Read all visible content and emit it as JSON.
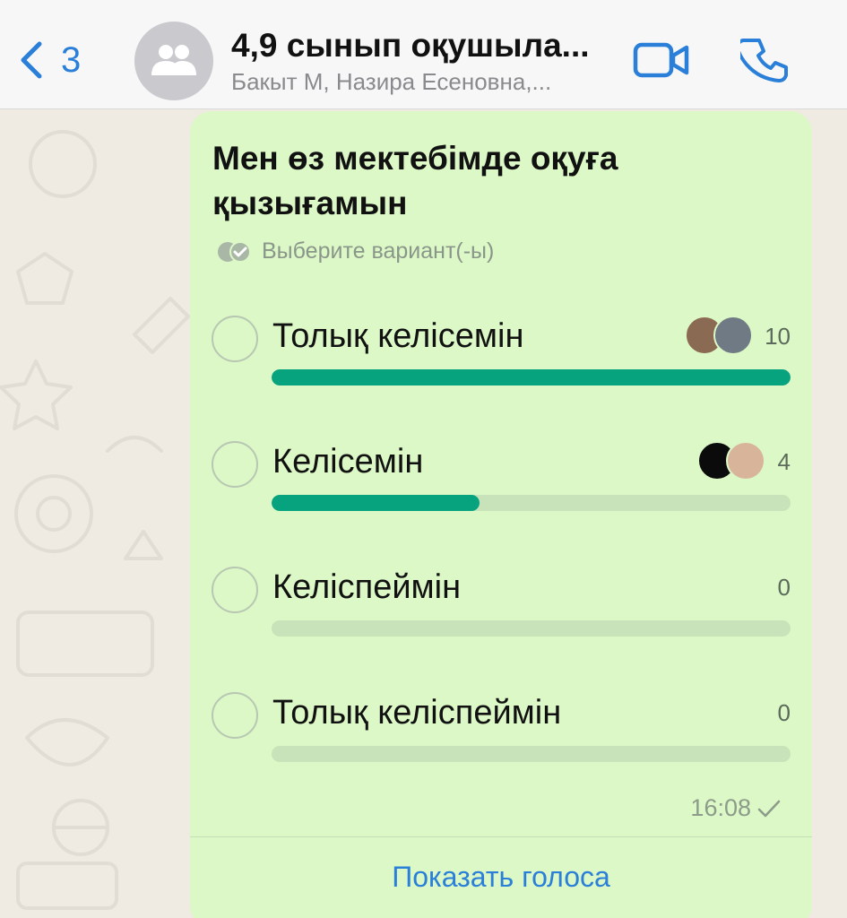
{
  "header": {
    "back_count": "3",
    "title": "4,9 сынып оқушыла...",
    "subtitle": "Бакыт М, Назира Есеновна,...",
    "icons": {
      "back": "chevron-left-icon",
      "avatar": "group-icon",
      "video": "video-camera-icon",
      "call": "phone-icon"
    }
  },
  "poll": {
    "question": "Мен өз мектебімде оқуға қызығамын",
    "hint": "Выберите вариант(-ы)",
    "options": [
      {
        "label": "Толық келісемін",
        "count": "10",
        "fraction": 1.0,
        "voters": [
          "#8a6a52",
          "#6f7a84"
        ]
      },
      {
        "label": "Келісемін",
        "count": "4",
        "fraction": 0.4,
        "voters": [
          "#0b0b0b",
          "#d8b49a"
        ]
      },
      {
        "label": "Келіспеймін",
        "count": "0",
        "fraction": 0,
        "voters": []
      },
      {
        "label": "Толық келіспеймін",
        "count": "0",
        "fraction": 0,
        "voters": []
      }
    ],
    "time": "16:08",
    "show_votes": "Показать голоса"
  },
  "colors": {
    "accent": "#2a7fd9",
    "bar": "#07a37f",
    "bubble": "#dcf8c6"
  }
}
